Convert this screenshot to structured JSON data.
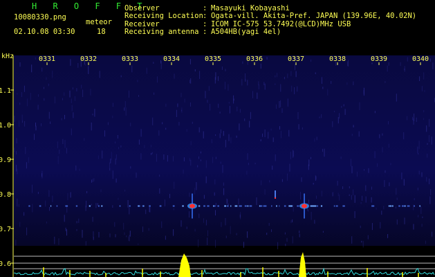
{
  "header": {
    "app_title": "H R O F F T",
    "filename": "10080330.png",
    "datetime": "02.10.08 03:30",
    "meteor_label": "meteor",
    "meteor_count": "18",
    "fields": [
      {
        "label": "Observer",
        "value": "Masayuki Kobayashi"
      },
      {
        "label": "Receiving Location",
        "value": "Ogata-vill. Akita-Pref. JAPAN (139.96E, 40.02N)"
      },
      {
        "label": "Receiver",
        "value": "ICOM IC-575 53.7492(@LCD)MHz USB"
      },
      {
        "label": "Receiving antenna",
        "value": "A504HB(yagi 4el)"
      }
    ]
  },
  "colors": {
    "header_text": "#ffff55",
    "title_text": "#33ee33",
    "background": "#000000",
    "spectrogram_bg": "#0b0b52",
    "hot_signal": "#ff3030",
    "counter_bar": "#ffff00",
    "noise_trace": "#33dddd"
  },
  "chart_data": {
    "type": "heatmap",
    "title": "",
    "xlabel": "",
    "ylabel": "kHz",
    "x_ticks": [
      "0331",
      "0332",
      "0333",
      "0334",
      "0335",
      "0336",
      "0337",
      "0338",
      "0339",
      "0340"
    ],
    "y_ticks": [
      "1.1",
      "1.0",
      "0.9",
      "0.8",
      "0.7",
      "0.6"
    ],
    "y_range": [
      0.57,
      1.17
    ],
    "signal_band_khz": 0.765,
    "events": [
      {
        "time": "0334.5",
        "freq_khz": 0.765,
        "strength": "strong"
      },
      {
        "time": "0337.2",
        "freq_khz": 0.765,
        "strength": "strong"
      },
      {
        "time": "0336.5",
        "freq_khz": 0.79,
        "strength": "weak"
      }
    ]
  }
}
